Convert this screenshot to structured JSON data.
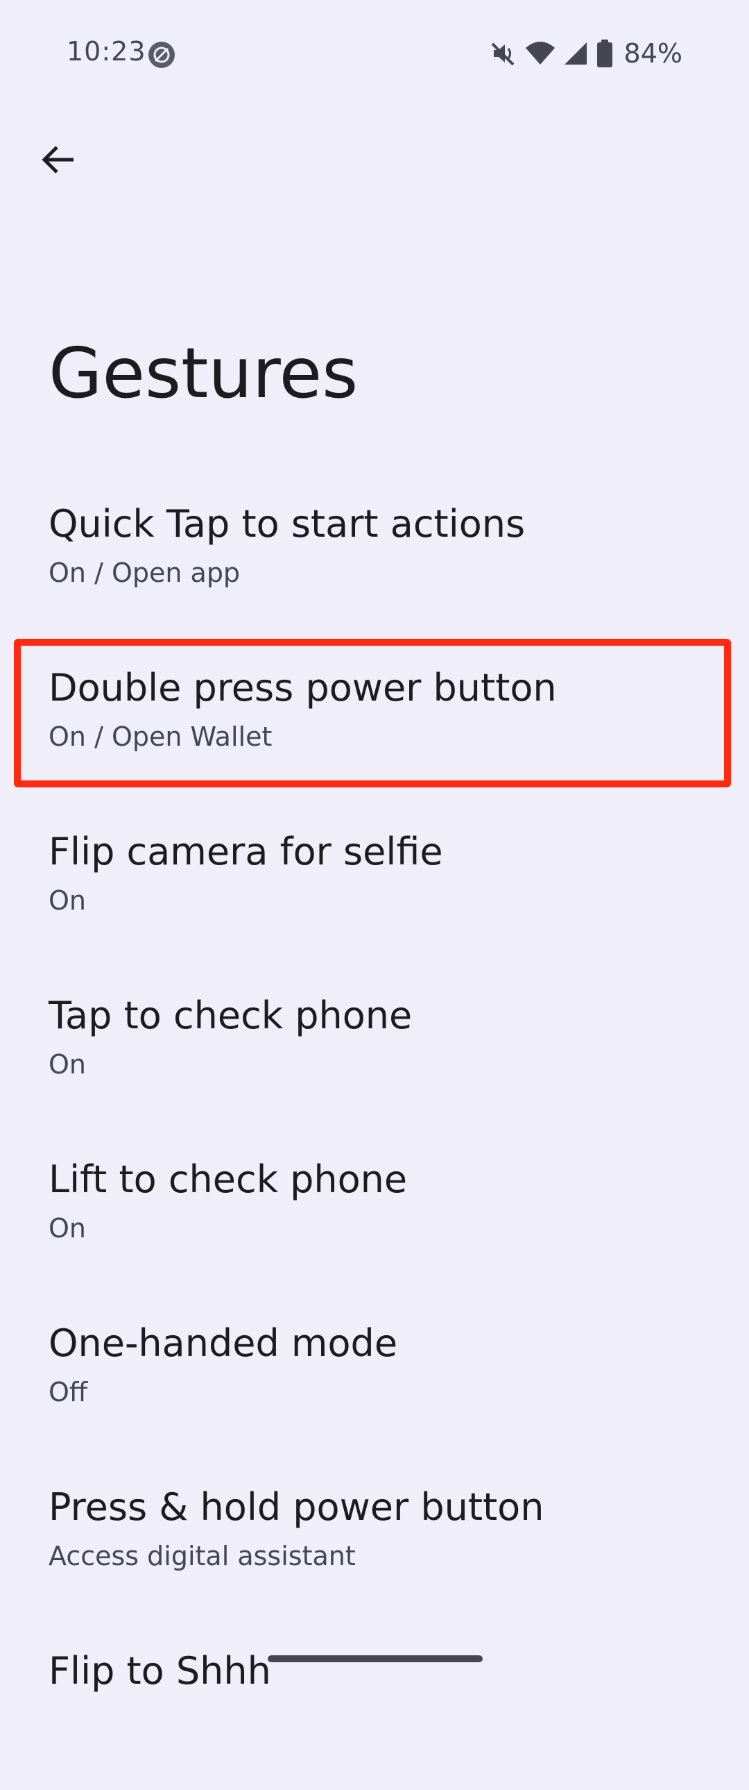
{
  "status_bar": {
    "time": "10:23",
    "left_icon": "app-notification-icon",
    "right_icons": [
      "mute-icon",
      "wifi-icon",
      "signal-icon",
      "battery-icon"
    ],
    "battery": "84%"
  },
  "header": {
    "back_icon": "back-arrow-icon",
    "title": "Gestures"
  },
  "settings": [
    {
      "title": "Quick Tap to start actions",
      "summary": "On / Open app"
    },
    {
      "title": "Double press power button",
      "summary": "On / Open Wallet"
    },
    {
      "title": "Flip camera for selfie",
      "summary": "On"
    },
    {
      "title": "Tap to check phone",
      "summary": "On"
    },
    {
      "title": "Lift to check phone",
      "summary": "On"
    },
    {
      "title": "One-handed mode",
      "summary": "Off"
    },
    {
      "title": "Press & hold power button",
      "summary": "Access digital assistant"
    },
    {
      "title": "Flip to Shhh",
      "summary": ""
    }
  ],
  "colors": {
    "background": "#efeef9",
    "highlight": "#ff2a12",
    "text_primary": "#1b1b21",
    "text_secondary": "#45464f"
  }
}
